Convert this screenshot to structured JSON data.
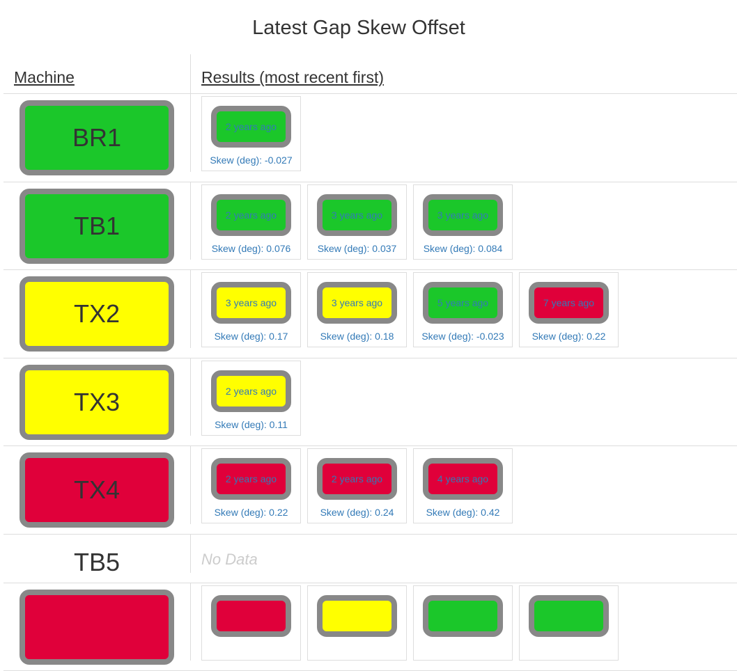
{
  "title": "Latest Gap Skew Offset",
  "headers": {
    "machine": "Machine",
    "results": "Results (most recent first)"
  },
  "colors": {
    "green": "#1bc72a",
    "yellow": "#ffff00",
    "red": "#e0003a",
    "border": "#888888",
    "link": "#337ab7"
  },
  "skew_label_prefix": "Skew (deg): ",
  "rows": [
    {
      "machine": "BR1",
      "status": "green",
      "results": [
        {
          "age": "2 years ago",
          "status": "green",
          "skew": "Skew (deg): -0.027"
        }
      ]
    },
    {
      "machine": "TB1",
      "status": "green",
      "results": [
        {
          "age": "2 years ago",
          "status": "green",
          "skew": "Skew (deg): 0.076"
        },
        {
          "age": "3 years ago",
          "status": "green",
          "skew": "Skew (deg): 0.037"
        },
        {
          "age": "3 years ago",
          "status": "green",
          "skew": "Skew (deg): 0.084"
        }
      ]
    },
    {
      "machine": "TX2",
      "status": "yellow",
      "results": [
        {
          "age": "3 years ago",
          "status": "yellow",
          "skew": "Skew (deg): 0.17"
        },
        {
          "age": "3 years ago",
          "status": "yellow",
          "skew": "Skew (deg): 0.18"
        },
        {
          "age": "5 years ago",
          "status": "green",
          "skew": "Skew (deg): -0.023"
        },
        {
          "age": "7 years ago",
          "status": "red",
          "skew": "Skew (deg): 0.22"
        }
      ]
    },
    {
      "machine": "TX3",
      "status": "yellow",
      "results": [
        {
          "age": "2 years ago",
          "status": "yellow",
          "skew": "Skew (deg): 0.11"
        }
      ]
    },
    {
      "machine": "TX4",
      "status": "red",
      "results": [
        {
          "age": "2 years ago",
          "status": "red",
          "skew": "Skew (deg): 0.22"
        },
        {
          "age": "2 years ago",
          "status": "red",
          "skew": "Skew (deg): 0.24"
        },
        {
          "age": "4 years ago",
          "status": "red",
          "skew": "Skew (deg): 0.42"
        }
      ]
    },
    {
      "machine": "TB5",
      "status": "none",
      "no_data": "No Data",
      "results": []
    },
    {
      "machine": "",
      "status": "red",
      "results": [
        {
          "age": "",
          "status": "red",
          "skew": ""
        },
        {
          "age": "",
          "status": "yellow",
          "skew": ""
        },
        {
          "age": "",
          "status": "green",
          "skew": ""
        },
        {
          "age": "",
          "status": "green",
          "skew": ""
        }
      ]
    }
  ]
}
